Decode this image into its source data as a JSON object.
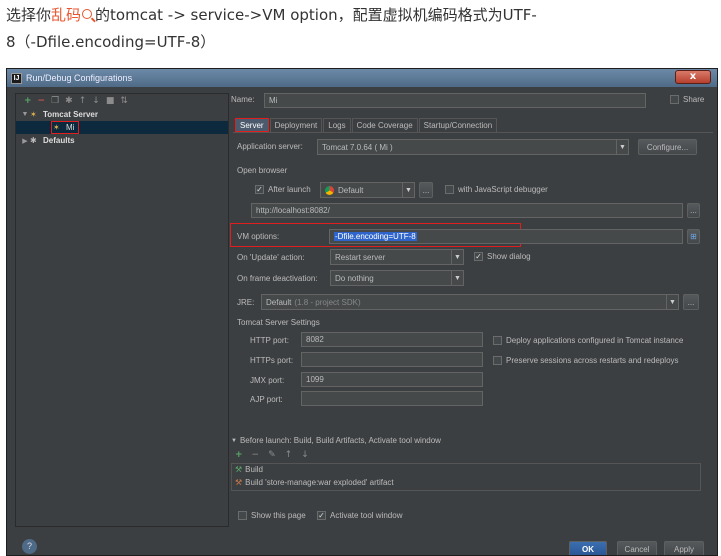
{
  "article": {
    "line1_pre": "选择你",
    "line1_kw": "乱码",
    "line1_post": "的tomcat -> service->VM option，配置虚拟机编码格式为UTF-",
    "line2": "8（-Dfile.encoding=UTF-8）"
  },
  "dialog": {
    "title": "Run/Debug Configurations",
    "close_label": "x",
    "tree": {
      "tomcat_server": "Tomcat Server",
      "mi": "Mi",
      "defaults": "Defaults"
    },
    "name_label": "Name:",
    "name_value": "Mi",
    "share_label": "Share",
    "tabs": [
      "Server",
      "Deployment",
      "Logs",
      "Code Coverage",
      "Startup/Connection"
    ],
    "app_server_label": "Application server:",
    "app_server_value": "Tomcat 7.0.64 ( Mi )",
    "configure_label": "Configure...",
    "open_browser_label": "Open browser",
    "after_launch_label": "After launch",
    "browser_value": "Default",
    "ellipsis": "...",
    "js_debugger_label": "with JavaScript debugger",
    "url_value": "http://localhost:8082/",
    "vm_options_label": "VM options:",
    "vm_options_value": "-Dfile.encoding=UTF-8",
    "on_update_label": "On 'Update' action:",
    "on_update_value": "Restart server",
    "show_dialog_label": "Show dialog",
    "on_frame_label": "On frame deactivation:",
    "on_frame_value": "Do nothing",
    "jre_label": "JRE:",
    "jre_value": "Default",
    "jre_hint": "(1.8 - project SDK)",
    "tomcat_settings_label": "Tomcat Server Settings",
    "http_port_label": "HTTP port:",
    "http_port_value": "8082",
    "https_port_label": "HTTPs port:",
    "https_port_value": "",
    "jmx_port_label": "JMX port:",
    "jmx_port_value": "1099",
    "ajp_port_label": "AJP port:",
    "ajp_port_value": "",
    "deploy_label": "Deploy applications configured in Tomcat instance",
    "preserve_label": "Preserve sessions across restarts and redeploys",
    "before_launch_label": "Before launch: Build, Build Artifacts, Activate tool window",
    "build_label": "Build",
    "build_artifact_label": "Build 'store-manage:war exploded' artifact",
    "show_page_label": "Show this page",
    "activate_tool_label": "Activate tool window",
    "ok_label": "OK",
    "cancel_label": "Cancel",
    "apply_label": "Apply",
    "help_label": "?"
  }
}
